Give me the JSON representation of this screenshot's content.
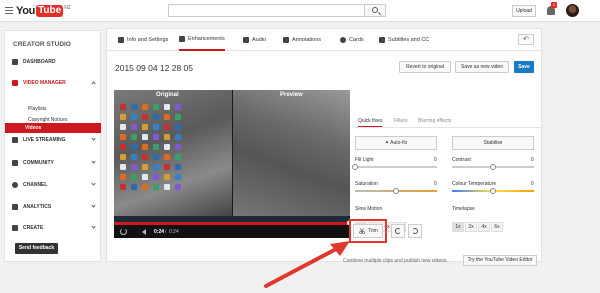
{
  "header": {
    "logo_you": "You",
    "logo_tube": "Tube",
    "logo_region": "NZ",
    "search_placeholder": "",
    "upload_label": "Upload",
    "notification_count": "1"
  },
  "sidebar": {
    "title": "CREATOR STUDIO",
    "items": [
      {
        "label": "DASHBOARD",
        "icon": "dashboard-icon"
      },
      {
        "label": "VIDEO MANAGER",
        "icon": "video-manager-icon"
      },
      {
        "label": "LIVE STREAMING",
        "icon": "live-streaming-icon"
      },
      {
        "label": "COMMUNITY",
        "icon": "community-icon"
      },
      {
        "label": "CHANNEL",
        "icon": "channel-icon"
      },
      {
        "label": "ANALYTICS",
        "icon": "analytics-icon"
      },
      {
        "label": "CREATE",
        "icon": "create-icon"
      }
    ],
    "sub_items": [
      "Videos",
      "Playlists",
      "Copyright Notices"
    ],
    "feedback_label": "Send feedback"
  },
  "tabs": [
    {
      "label": "Info and Settings",
      "icon": "pencil-icon"
    },
    {
      "label": "Enhancements",
      "icon": "wand-icon"
    },
    {
      "label": "Audio",
      "icon": "music-note-icon"
    },
    {
      "label": "Annotations",
      "icon": "speech-bubble-icon"
    },
    {
      "label": "Cards",
      "icon": "info-icon"
    },
    {
      "label": "Subtitles and CC",
      "icon": "cc-icon"
    }
  ],
  "video": {
    "title": "2015 09 04 12 28 05",
    "label_original": "Original",
    "label_preview": "Preview",
    "time_current": "0:24",
    "time_separator": "/",
    "time_total": "0:24",
    "progress_fraction": 1.0
  },
  "actions": {
    "revert_label": "Revert to original",
    "save_as_new_label": "Save as new video",
    "save_label": "Save"
  },
  "enhance": {
    "subtabs": [
      "Quick fixes",
      "Filters",
      "Blurring effects"
    ],
    "autofix_label": "Auto-fix",
    "stabilise_label": "Stabilise",
    "sliders": [
      {
        "label": "Fill Light",
        "value": "0",
        "level": 0.0
      },
      {
        "label": "Contrast",
        "value": "0",
        "level": 0.5
      },
      {
        "label": "Saturation",
        "value": "0",
        "level": 0.5
      },
      {
        "label": "Colour Temperature",
        "value": "0",
        "level": 0.5
      }
    ],
    "slow_motion_label": "Slow Motion",
    "slow_motion_options": [
      "1x",
      "2x",
      "4x",
      "8x"
    ],
    "timelapse_label": "Timelapse",
    "timelapse_options": [
      "1x",
      "2x",
      "4x",
      "6x"
    ]
  },
  "toolbar": {
    "trim_label": "Trim",
    "combine_text": "Combine multiple clips and publish new videos.",
    "video_editor_label": "Try the YouTube Video Editor"
  },
  "colors": {
    "brand_red": "#cc181e",
    "save_blue": "#167ac6",
    "annotation_red": "#e0382f"
  }
}
